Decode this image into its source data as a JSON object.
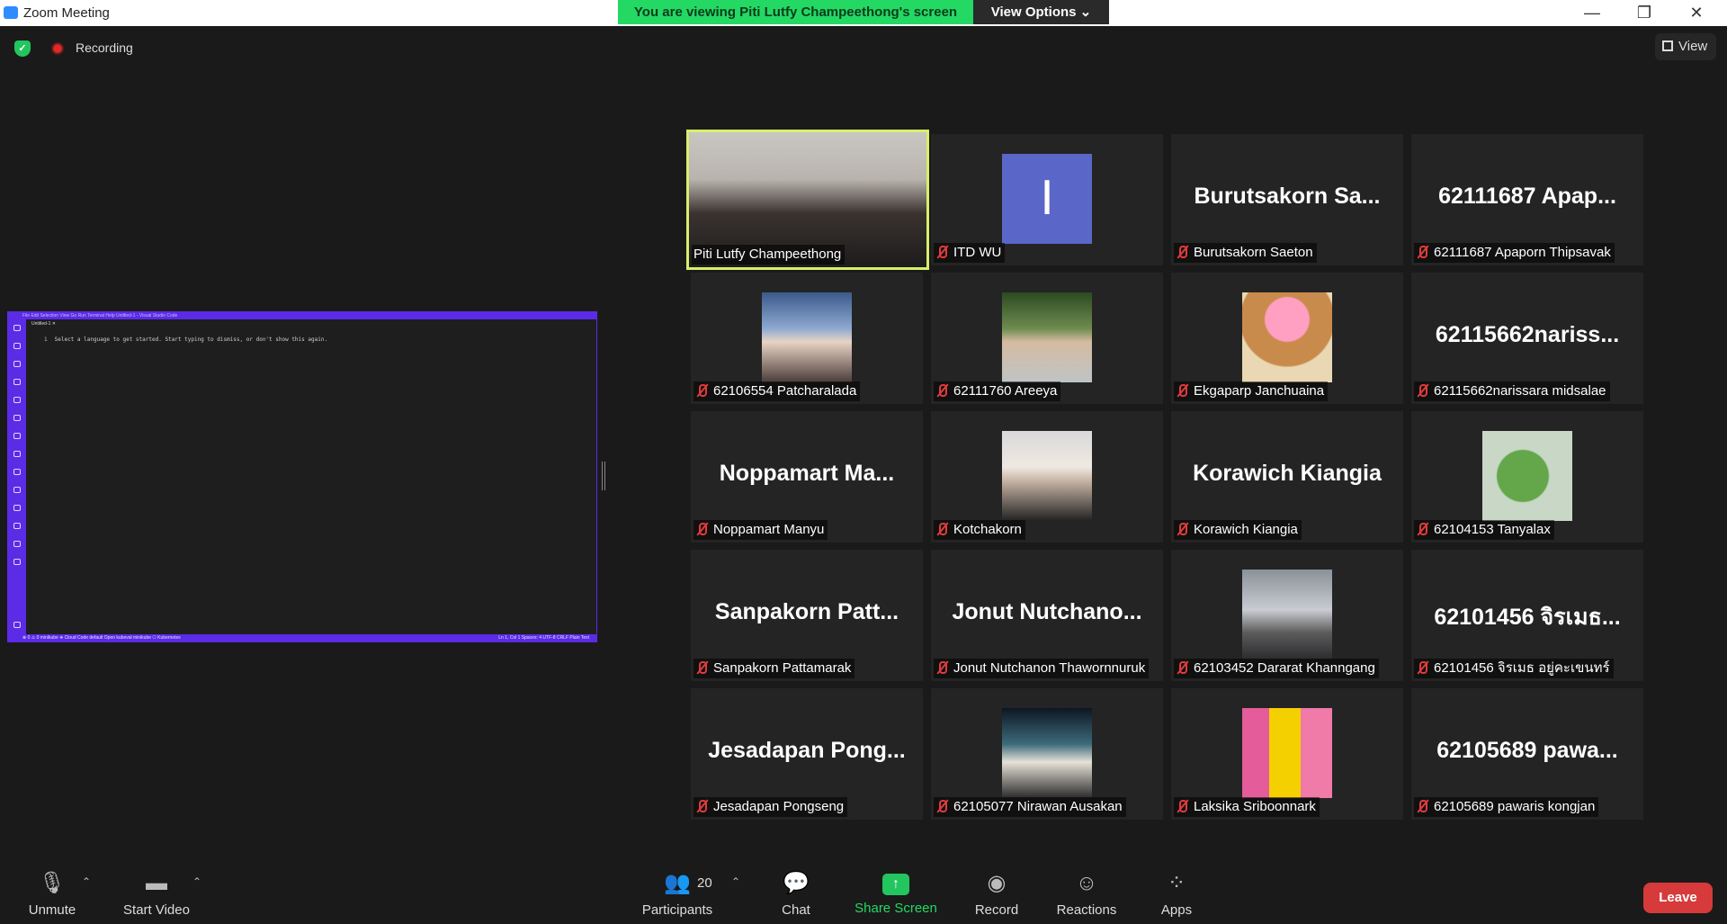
{
  "window": {
    "title": "Zoom Meeting",
    "minimize": "—",
    "restore": "❐",
    "close": "✕"
  },
  "banner": {
    "viewing": "You are viewing Piti Lutfy Champeethong's screen",
    "view_options": "View Options ⌄"
  },
  "status": {
    "recording": "Recording"
  },
  "view_button": "View",
  "shared_screen": {
    "app": "Visual Studio Code",
    "title_text": "File   Edit   Selection   View   Go   Run   Terminal   Help                                                    Untitled-1 - Visual Studio Code",
    "tab": "Untitled-1  ✕",
    "line_number": "1",
    "editor_text": "Select a language to get started. Start typing to dismiss, or don't show this again.",
    "status_left": "⊗ 0 ⚠ 0    minikube    ⎈ Cloud Code    default    Open kubeval    minikube    ⎔ Kubernetes",
    "status_right": "Ln 1, Col 1    Spaces: 4    UTF-8    CRLF    Plain Text"
  },
  "participants": [
    {
      "name": "Piti Lutfy Champeethong",
      "display": "",
      "avatar": "cam-photo",
      "muted": false,
      "active": true
    },
    {
      "name": "ITD WU",
      "display": "",
      "avatar": "letter",
      "letter": "I",
      "muted": true
    },
    {
      "name": "Burutsakorn Saeton",
      "display": "Burutsakorn Sa...",
      "muted": true
    },
    {
      "name": "62111687 Apaporn Thipsavak",
      "display": "62111687 Apap...",
      "muted": true
    },
    {
      "name": "62106554 Patcharalada",
      "display": "",
      "avatar": "face",
      "muted": true
    },
    {
      "name": "62111760 Areeya",
      "display": "",
      "avatar": "girl",
      "muted": true
    },
    {
      "name": "Ekgaparp Janchuaina",
      "display": "",
      "avatar": "dog",
      "muted": true
    },
    {
      "name": "62115662narissara midsalae",
      "display": "62115662nariss...",
      "muted": true
    },
    {
      "name": "Noppamart Manyu",
      "display": "Noppamart Ma...",
      "muted": true
    },
    {
      "name": "Kotchakorn",
      "display": "",
      "avatar": "girl2",
      "muted": true
    },
    {
      "name": "Korawich Kiangia",
      "display": "Korawich Kiangia",
      "muted": true
    },
    {
      "name": "62104153 Tanyalax",
      "display": "",
      "avatar": "pepe",
      "muted": true
    },
    {
      "name": "Sanpakorn Pattamarak",
      "display": "Sanpakorn Patt...",
      "muted": true
    },
    {
      "name": "Jonut Nutchanon Thawornnuruk",
      "display": "Jonut Nutchano...",
      "muted": true
    },
    {
      "name": "62103452 Dararat Khanngang",
      "display": "",
      "avatar": "tower",
      "muted": true
    },
    {
      "name": "62101456 จิรเมธ อยู่คะเขนทร์",
      "display": "62101456 จิรเมธ...",
      "muted": true
    },
    {
      "name": "Jesadapan Pongseng",
      "display": "Jesadapan Pong...",
      "muted": true
    },
    {
      "name": "62105077 Nirawan Ausakan",
      "display": "",
      "avatar": "night",
      "muted": true
    },
    {
      "name": "Laksika Sriboonnark",
      "display": "",
      "avatar": "pink",
      "muted": true
    },
    {
      "name": "62105689 pawaris kongjan",
      "display": "62105689 pawa...",
      "muted": true
    }
  ],
  "toolbar": {
    "unmute": "Unmute",
    "start_video": "Start Video",
    "participants": "Participants",
    "participant_count": "20",
    "chat": "Chat",
    "share_screen": "Share Screen",
    "record": "Record",
    "reactions": "Reactions",
    "apps": "Apps",
    "leave": "Leave"
  },
  "colors": {
    "share_green": "#23d964",
    "leave_red": "#d63a3a",
    "active_speaker": "#d7ef6a",
    "vscode_purple": "#5b2be6",
    "mute_red": "#e23b3b"
  }
}
